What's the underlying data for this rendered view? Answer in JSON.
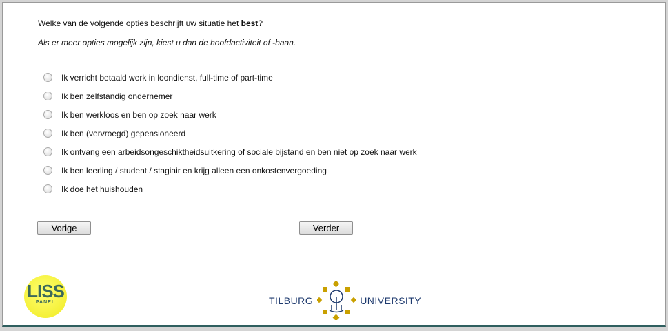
{
  "question": {
    "text_before": "Welke van de volgende opties beschrijft uw situatie het ",
    "text_bold": "best",
    "text_after": "?"
  },
  "instruction": "Als er meer opties mogelijk zijn, kiest u dan de hoofdactiviteit of -baan.",
  "options": [
    "Ik verricht betaald werk in loondienst, full-time of part-time",
    "Ik ben zelfstandig ondernemer",
    "Ik ben werkloos en ben op zoek naar werk",
    "Ik ben (vervroegd) gepensioneerd",
    "Ik ontvang een arbeidsongeschiktheidsuitkering of sociale bijstand en ben niet op zoek naar werk",
    "Ik ben leerling / student / stagiair en krijg alleen een onkostenvergoeding",
    "Ik doe het huishouden"
  ],
  "buttons": {
    "prev": "Vorige",
    "next": "Verder"
  },
  "logos": {
    "liss_top": "LISS",
    "liss_bottom": "PANEL",
    "tilburg_left": "TILBURG",
    "tilburg_right": "UNIVERSITY"
  },
  "colors": {
    "gold": "#c9a000",
    "navy": "#1e3a6e"
  }
}
